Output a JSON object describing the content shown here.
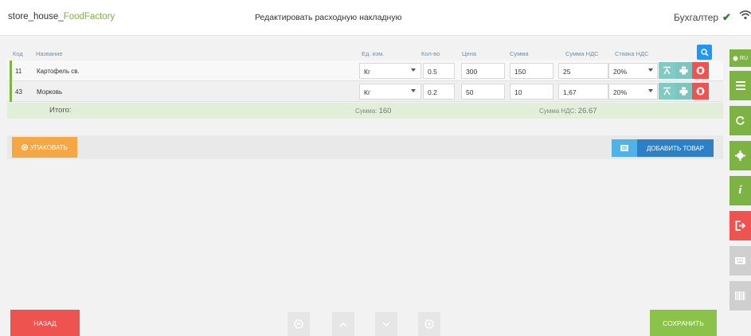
{
  "header": {
    "brand_prefix": "store_house_",
    "brand_accent": "FoodFactory",
    "title": "Редактировать расходную накладную",
    "role": "Бухгалтер"
  },
  "table": {
    "columns": {
      "code": "Код",
      "name": "Название",
      "unit": "Ед. изм.",
      "qty": "Кол-во",
      "price": "Цена",
      "sum": "Сумма",
      "vat_sum": "Сумма НДС",
      "vat_rate": "Ставка НДС"
    },
    "rows": [
      {
        "code": "11",
        "name": "Картофель св.",
        "unit": "Кг",
        "qty": "0.5",
        "price": "300",
        "sum": "150",
        "vat_sum": "25",
        "vat_rate": "20%"
      },
      {
        "code": "43",
        "name": "Морковь",
        "unit": "Кг",
        "qty": "0.2",
        "price": "50",
        "sum": "10",
        "vat_sum": "1,67",
        "vat_rate": "20%"
      }
    ],
    "totals": {
      "label": "Итого:",
      "sum_label": "Сумма:",
      "sum_value": "160",
      "vat_label": "Сумма НДС:",
      "vat_value": "26.67"
    }
  },
  "actions": {
    "pack_label": "УПАКОВАТЬ",
    "add_label": "ДОБАВИТЬ ТОВАР"
  },
  "sidebar": {
    "lang": "RU"
  },
  "footer": {
    "back_label": "НАЗАД",
    "save_label": "СОХРАНИТЬ"
  },
  "colors": {
    "green": "#7cb342",
    "red": "#ef5350",
    "blue": "#2d7fc6",
    "orange": "#f4a742",
    "teal": "#80cbc4",
    "grey": "#cfcfcf"
  }
}
